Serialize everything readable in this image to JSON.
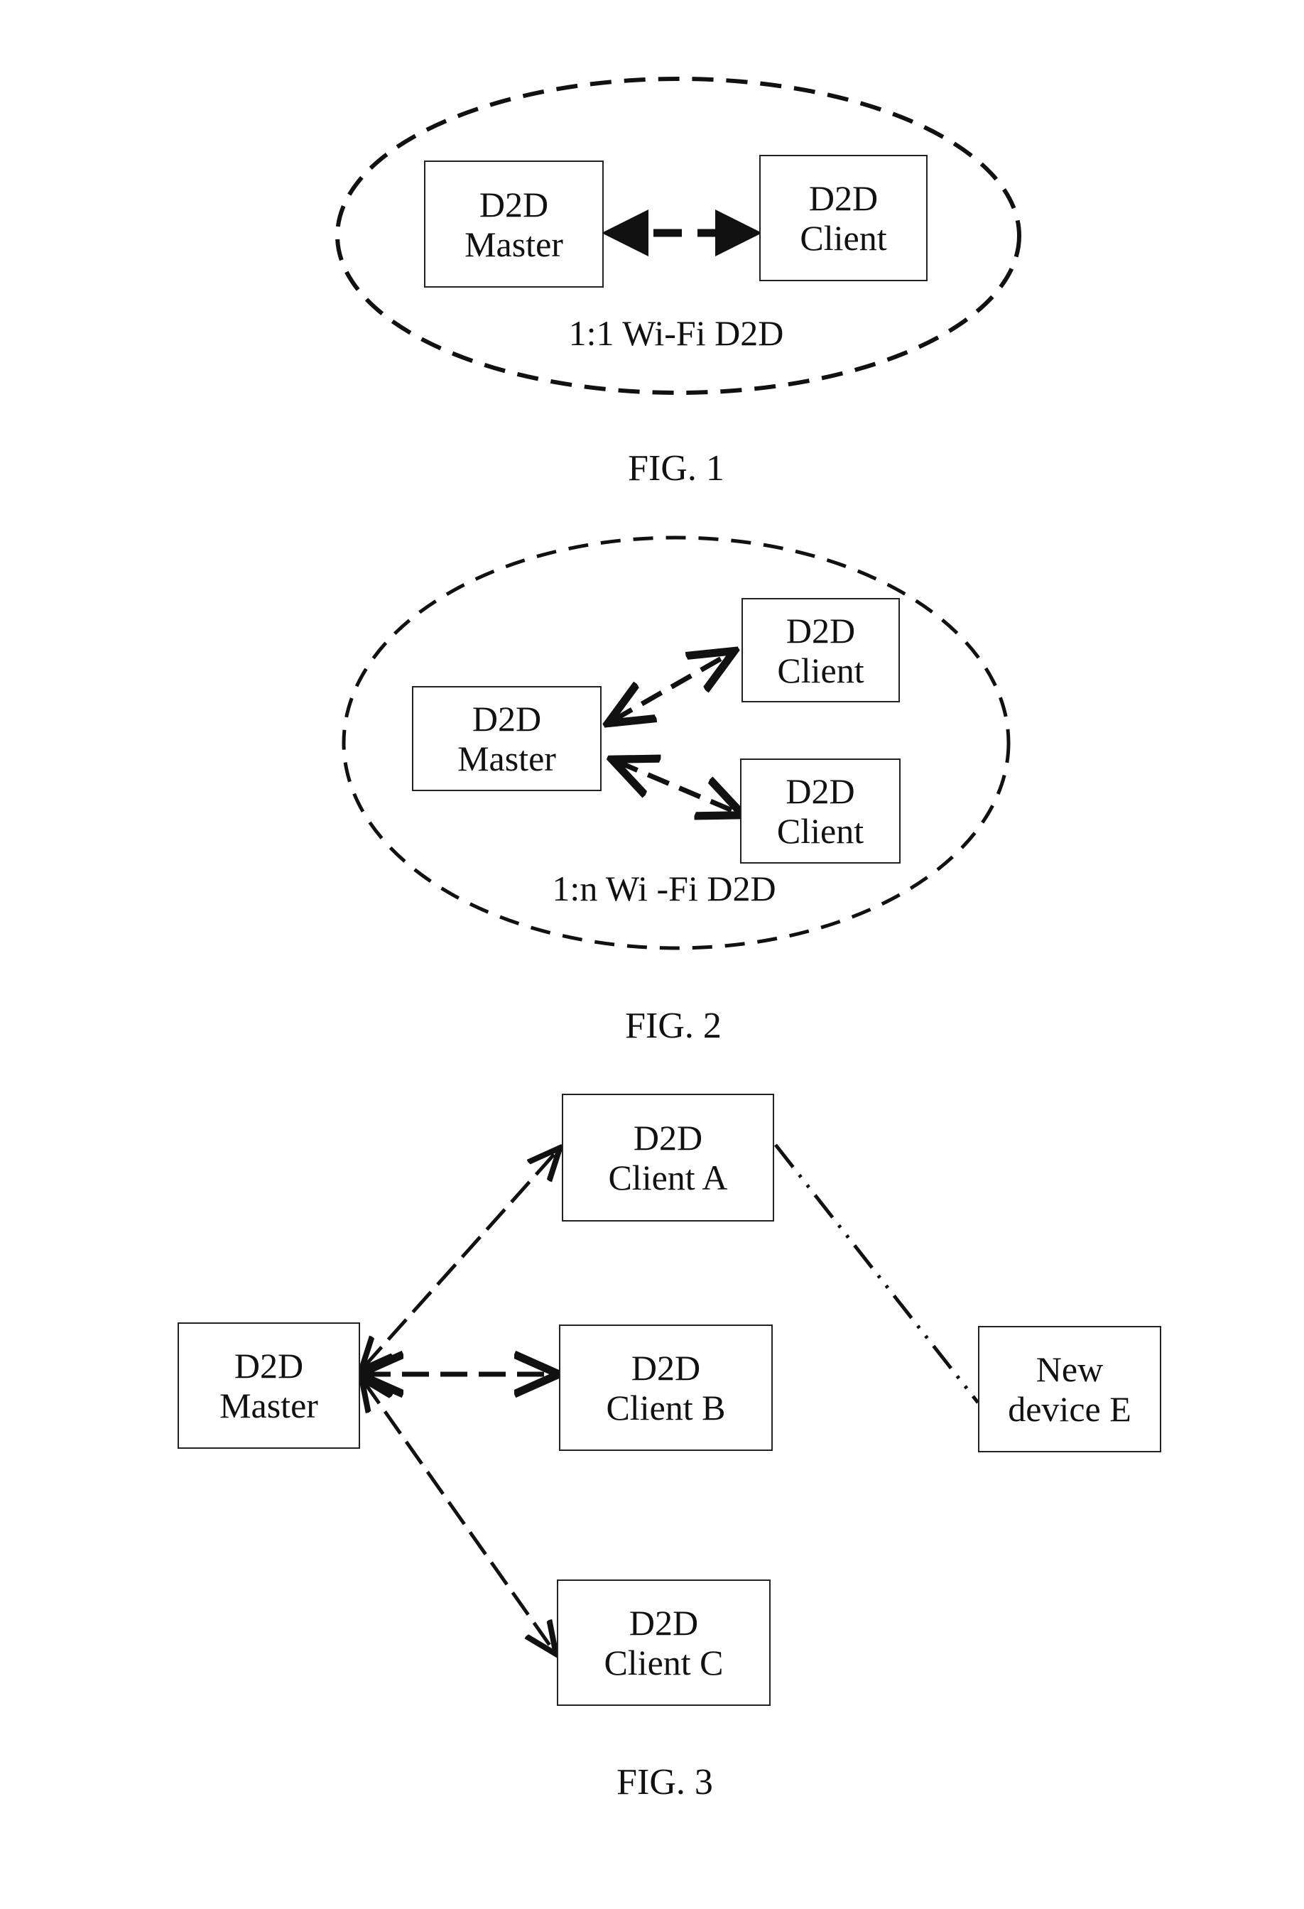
{
  "fig1": {
    "caption": "FIG. 1",
    "group_label": "1:1 Wi-Fi D2D",
    "master": {
      "line1": "D2D",
      "line2": "Master"
    },
    "client": {
      "line1": "D2D",
      "line2": "Client"
    }
  },
  "fig2": {
    "caption": "FIG. 2",
    "group_label": "1:n Wi -Fi D2D",
    "master": {
      "line1": "D2D",
      "line2": "Master"
    },
    "client1": {
      "line1": "D2D",
      "line2": "Client"
    },
    "client2": {
      "line1": "D2D",
      "line2": "Client"
    }
  },
  "fig3": {
    "caption": "FIG. 3",
    "master": {
      "line1": "D2D",
      "line2": "Master"
    },
    "client_a": {
      "line1": "D2D",
      "line2": "Client A"
    },
    "client_b": {
      "line1": "D2D",
      "line2": "Client B"
    },
    "client_c": {
      "line1": "D2D",
      "line2": "Client C"
    },
    "new_device": {
      "line1": "New",
      "line2": "device E"
    }
  }
}
